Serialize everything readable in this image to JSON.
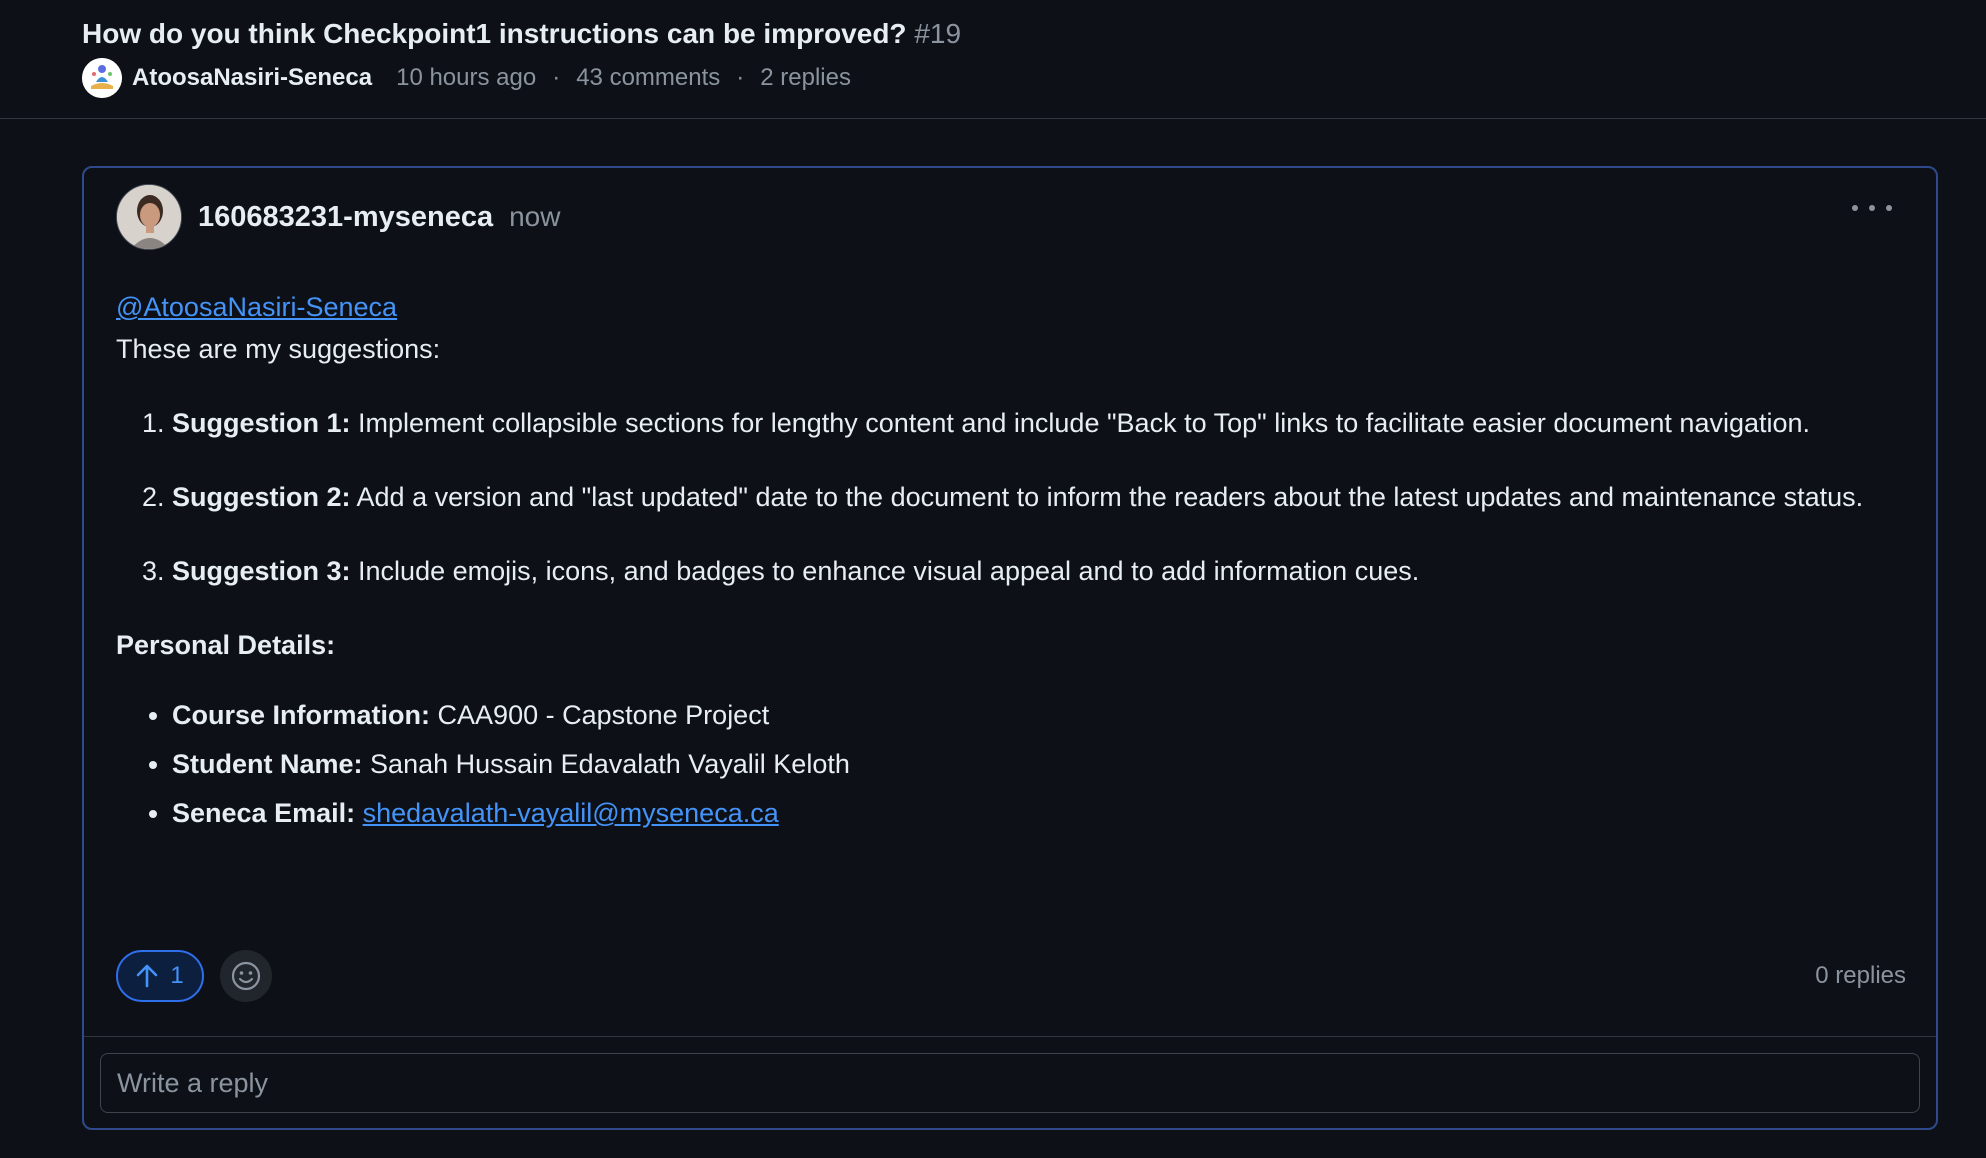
{
  "discussion": {
    "title": "How do you think Checkpoint1 instructions can be improved?",
    "number": "#19",
    "author": "AtoosaNasiri-Seneca",
    "time": "10 hours ago",
    "comments": "43 comments",
    "replies": "2 replies"
  },
  "comment": {
    "username": "160683231-myseneca",
    "time": "now",
    "mention": "@AtoosaNasiri-Seneca",
    "intro": "These are my suggestions:",
    "suggestions": [
      {
        "label": "Suggestion 1:",
        "text": "Implement collapsible sections for lengthy content and include \"Back to Top\" links to facilitate easier document navigation."
      },
      {
        "label": "Suggestion 2:",
        "text": "Add a version and \"last updated\" date to the document to inform the readers about the latest updates and maintenance status."
      },
      {
        "label": "Suggestion 3:",
        "text": "Include emojis, icons, and badges to enhance visual appeal and to add information cues."
      }
    ],
    "personal_title": "Personal Details:",
    "details": [
      {
        "label": "Course Information:",
        "value": "CAA900 - Capstone Project"
      },
      {
        "label": "Student Name:",
        "value": "Sanah Hussain Edavalath Vayalil Keloth"
      },
      {
        "label": "Seneca Email:",
        "value": "shedavalath-vayalil@myseneca.ca"
      }
    ],
    "upvotes": "1",
    "replies_count": "0 replies"
  },
  "reply": {
    "placeholder": "Write a reply"
  },
  "icons": {
    "upvote": "arrow-up-icon",
    "emoji": "smiley-icon",
    "menu": "kebab-horizontal-icon"
  },
  "colors": {
    "background": "#0d1117",
    "accent": "#4493f8",
    "border_focus": "#2f4a8a",
    "muted": "#8b949e"
  }
}
